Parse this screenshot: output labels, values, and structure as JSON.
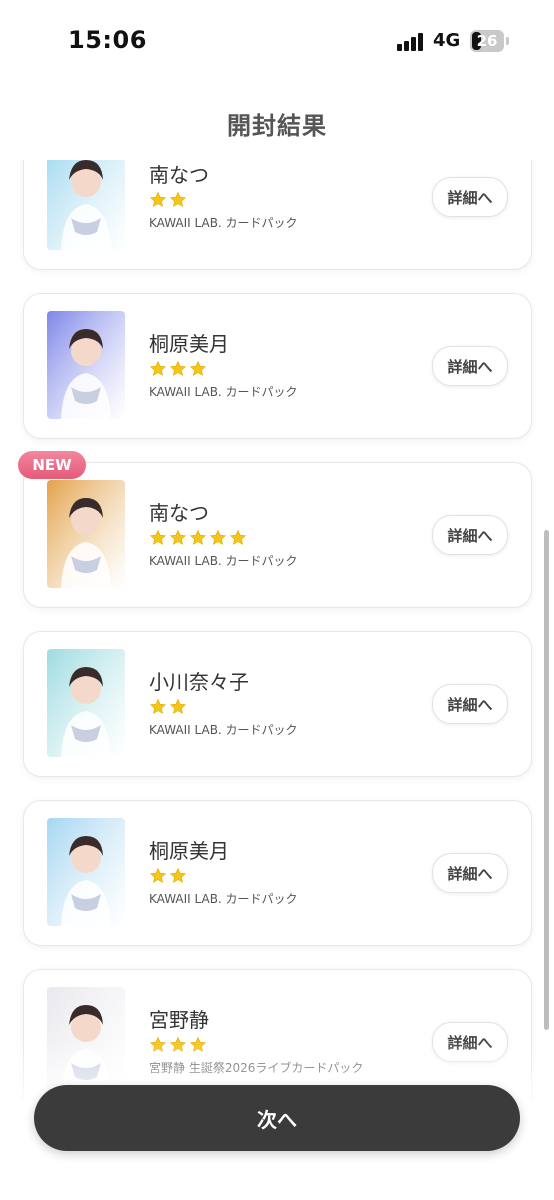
{
  "status_bar": {
    "time": "15:06",
    "network": "4G",
    "battery": "26"
  },
  "header": {
    "title": "開封結果"
  },
  "cards": [
    {
      "name": "南なつ",
      "stars": 2,
      "pack": "KAWAII LAB. カードパック",
      "detail_label": "詳細へ",
      "is_new": false,
      "thumb_theme": "#9fd8ef"
    },
    {
      "name": "桐原美月",
      "stars": 3,
      "pack": "KAWAII LAB. カードパック",
      "detail_label": "詳細へ",
      "is_new": false,
      "thumb_theme": "#7d86e8"
    },
    {
      "name": "南なつ",
      "stars": 5,
      "pack": "KAWAII LAB. カードパック",
      "detail_label": "詳細へ",
      "is_new": true,
      "new_label": "NEW",
      "thumb_theme": "#e3a24a"
    },
    {
      "name": "小川奈々子",
      "stars": 2,
      "pack": "KAWAII LAB. カードパック",
      "detail_label": "詳細へ",
      "is_new": false,
      "thumb_theme": "#9ddbe0"
    },
    {
      "name": "桐原美月",
      "stars": 2,
      "pack": "KAWAII LAB. カードパック",
      "detail_label": "詳細へ",
      "is_new": false,
      "thumb_theme": "#a6d6f2"
    },
    {
      "name": "宮野静",
      "stars": 3,
      "pack": "宮野静 生誕祭2026ライブカードパック",
      "detail_label": "詳細へ",
      "is_new": false,
      "thumb_theme": "#e9e9ee"
    }
  ],
  "footer": {
    "next_label": "次へ"
  },
  "colors": {
    "star": "#f5c518",
    "new_badge": "#e9657f",
    "next_button": "#3b3b3b"
  }
}
